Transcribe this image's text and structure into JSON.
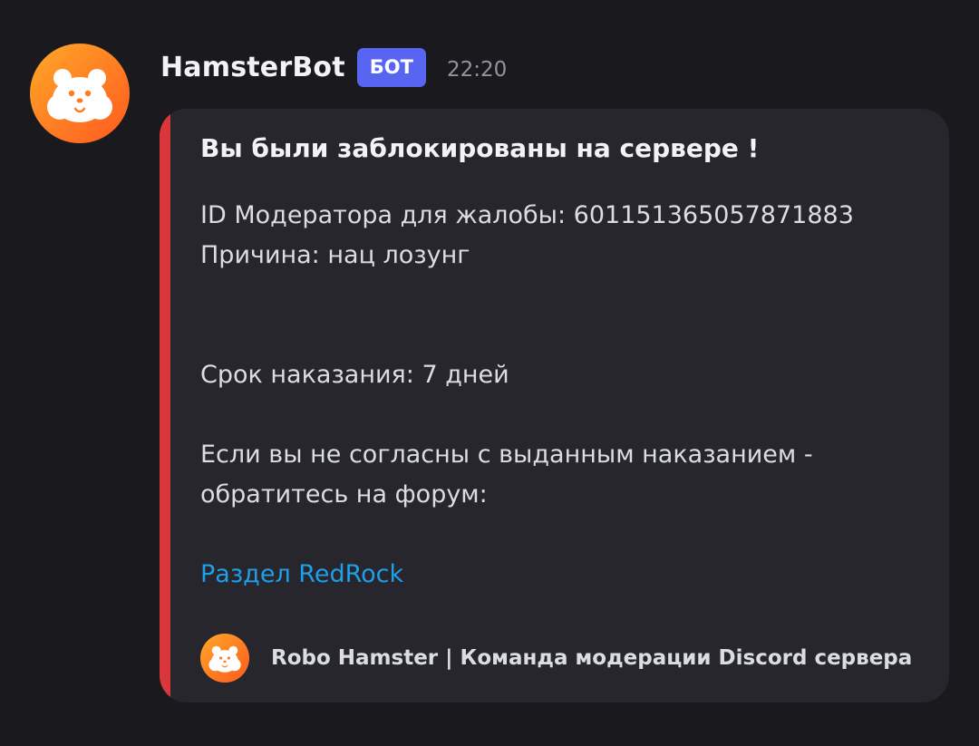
{
  "author": {
    "username": "HamsterBot",
    "tag": "БОТ",
    "timestamp": "22:20",
    "avatar_icon": "hamster-icon"
  },
  "embed": {
    "accent_color": "#da373c",
    "title": "Вы были заблокированы на сервере !",
    "description": {
      "moderator_id": "ID Модератора для жалобы: 601151365057871883",
      "reason": "Причина: нац лозунг",
      "duration": "Срок наказания: 7 дней",
      "appeal_line1": "Если вы не согласны с выданным наказанием -",
      "appeal_line2": "обратитесь на форум:",
      "link_text": "Раздел RedRock"
    },
    "footer": {
      "text": "Robo Hamster | Команда модерации Discord сервера",
      "icon": "hamster-icon"
    }
  },
  "colors": {
    "background": "#1a1a1e",
    "embed_background": "#26262c",
    "bot_tag": "#5865f2",
    "link": "#1e9fe8",
    "avatar_gradient": [
      "#ffa928",
      "#ff5a1f"
    ]
  }
}
